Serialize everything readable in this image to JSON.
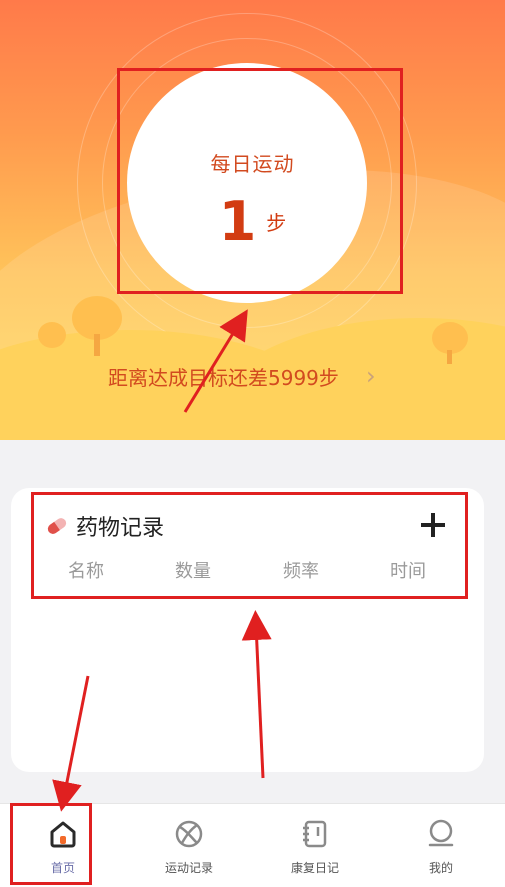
{
  "hero": {
    "title": "每日运动",
    "steps_value": "1",
    "steps_unit": "步",
    "goal_text": "距离达成目标还差5999步",
    "goal_chevron": "›"
  },
  "medicine_card": {
    "title": "药物记录",
    "add_icon": "plus-icon",
    "columns": [
      "名称",
      "数量",
      "频率",
      "时间"
    ]
  },
  "tabbar": {
    "items": [
      {
        "label": "首页",
        "icon": "home-icon",
        "active": true
      },
      {
        "label": "运动记录",
        "icon": "ball-icon",
        "active": false
      },
      {
        "label": "康复日记",
        "icon": "notebook-icon",
        "active": false
      },
      {
        "label": "我的",
        "icon": "user-icon",
        "active": false
      }
    ]
  },
  "colors": {
    "accent_text": "#d24a1f",
    "annotation": "#e02020",
    "active_tab": "#6a6ea8"
  }
}
